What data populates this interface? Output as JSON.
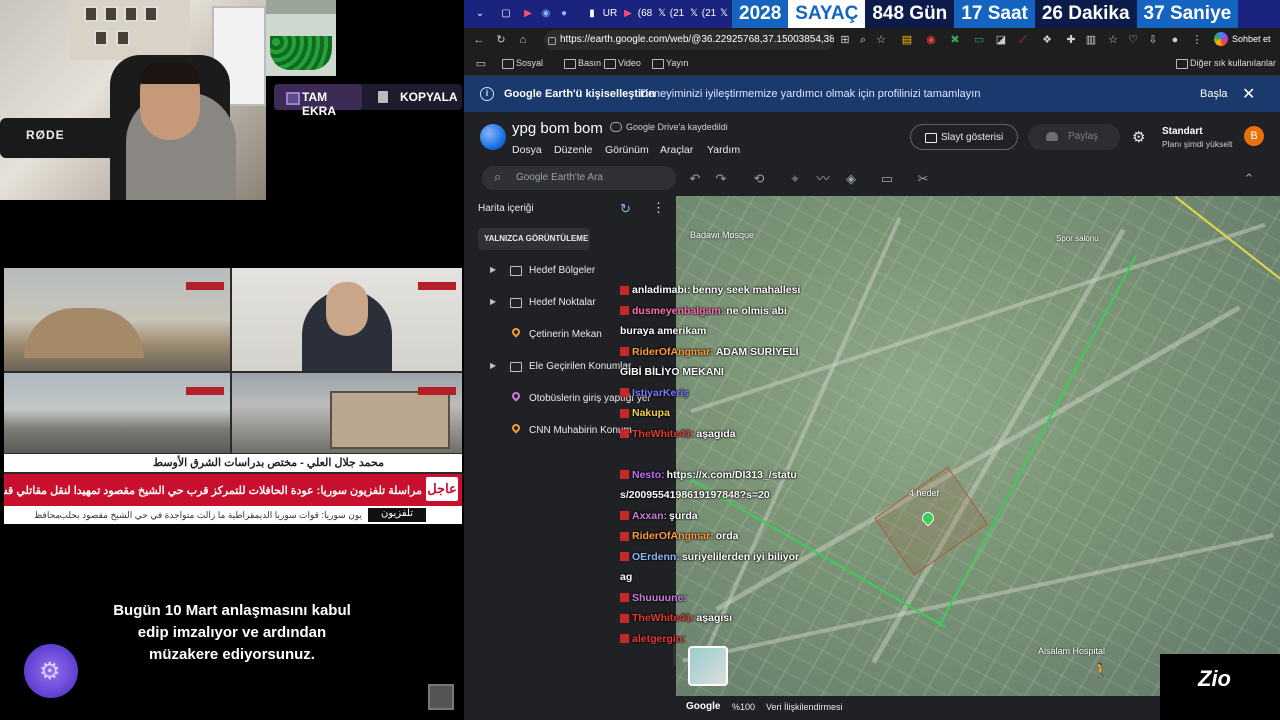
{
  "stream": {
    "overlay_buttons": {
      "fullscreen": "TAM EKRA",
      "copy": "KOPYALA"
    },
    "mic_brand": "RØDE",
    "subtitle": "Bugün 10 Mart anlaşmasını kabul edip imzalıyor ve ardından müzakere ediyorsunuz."
  },
  "news": {
    "ticker_name": "محمد جلال العلي - مختص بدراسات الشرق الأوسط",
    "ticker_headline": "مراسلة تلفزيون سوريا: عودة الحافلات للتمركز قرب حي الشيخ مقصود تمهيدا لنقل مقاتلي قسد",
    "breaking_label": "عاجل",
    "ticker_bottom": "يون سوريا: قوات سوريا الديمقراطية ما زالت متواجدة في حي الشيخ مقصود بحلب",
    "ticker_bottom_left": "محافظ",
    "channel_logo": "تلفزيون"
  },
  "browser": {
    "tabs_short": [
      "UR",
      "(68",
      "(21",
      "(21"
    ],
    "countdown": {
      "year": "2028",
      "label": "SAYAÇ",
      "days": "848 Gün",
      "hours": "17 Saat",
      "minutes": "26 Dakika",
      "seconds": "37 Saniye"
    },
    "url": "https://earth.google.com/web/@36.22925768,37.15003854,38...",
    "chat_button": "Sohbet et",
    "left_bookmarks": "Diğer sık kullanılanlar",
    "bookmarks": [
      "Sosyal",
      "Basın",
      "Video",
      "Yayın"
    ],
    "other_bookmarks": "Diğer sık kullanılanlar"
  },
  "infobar": {
    "title": "Google Earth'ü kişiselleştirin",
    "message": "Deneyiminizi iyileştirmemize yardımcı olmak için profilinizi tamamlayın",
    "start": "Başla"
  },
  "earth": {
    "project_title": "ypg bom bom",
    "saved_status": "Google Drive'a kaydedildi",
    "menu": [
      "Dosya",
      "Düzenle",
      "Görünüm",
      "Araçlar",
      "Yardım"
    ],
    "slideshow": "Slayt gösterisi",
    "share": "Paylaş",
    "plan_name": "Standart",
    "plan_upgrade": "Planı şimdi yükselt",
    "avatar_letter": "B",
    "search_placeholder": "Google Earth'te Ara",
    "panel_title": "Harita içeriği",
    "view_only": "YALNIZCA GÖRÜNTÜLEME",
    "items": [
      {
        "label": "Hedef Bölgeler",
        "kind": "folder"
      },
      {
        "label": "Hedef Noktalar",
        "kind": "folder"
      },
      {
        "label": "Çetinerin Mekan",
        "kind": "pin",
        "color": "#f29b38"
      },
      {
        "label": "Ele Geçirilen Konumlar",
        "kind": "folder"
      },
      {
        "label": "Otobüslerin giriş yaptığı yer",
        "kind": "pin",
        "color": "#c77ddb"
      },
      {
        "label": "CNN Muhabirin Konum",
        "kind": "pin",
        "color": "#f29b38"
      }
    ],
    "map_labels": {
      "badawi": "Badawi Mosque",
      "hedef": "4 hedef",
      "hospital": "Alsalam Hospital",
      "spor": "Spor salonu"
    },
    "footer": {
      "brand": "Google",
      "zoom": "%100",
      "credits": "Veri İlişkilendirmesi"
    }
  },
  "chat": [
    {
      "user": "anladimabi:",
      "text": "benny seek mahallesi",
      "color": "#ffffff"
    },
    {
      "user": "dusmeyenbalgam:",
      "text": "ne olmis abi",
      "color": "#ff6fb5"
    },
    {
      "user": "",
      "text": "buraya amerikam",
      "color": "#ffffff"
    },
    {
      "user": "RiderOfAngmar:",
      "text": "ADAM SURİYELİ",
      "color": "#ff9b3d"
    },
    {
      "user": "",
      "text": "GİBİ BİLİYO MEKANI",
      "color": "#ffffff"
    },
    {
      "user": "IstiyarKeriş",
      "text": "",
      "color": "#7a7aff"
    },
    {
      "user": "Nakupa",
      "text": "",
      "color": "#f2d14a"
    },
    {
      "user": "TheWhite41:",
      "text": "aşagıda",
      "color": "#e53935"
    },
    {
      "user": "",
      "text": "",
      "color": "#ffffff"
    },
    {
      "user": "Nesto:",
      "text": "https://x.com/DI313_/statu",
      "color": "#b96cff"
    },
    {
      "user": "",
      "text": "s/2009554198619197848?s=20",
      "color": "#ffffff"
    },
    {
      "user": "Axxan:",
      "text": "şurda",
      "color": "#c77ddb"
    },
    {
      "user": "RiderOfAngmar:",
      "text": "orda",
      "color": "#ff9b3d"
    },
    {
      "user": "OErdenn:",
      "text": "suriyelilerden iyi biliyor",
      "color": "#8ab4f8"
    },
    {
      "user": "",
      "text": "ag",
      "color": "#ffffff"
    },
    {
      "user": "Shuuuune:",
      "text": "",
      "color": "#c77ddb"
    },
    {
      "user": "TheWhite41:",
      "text": "aşagısı",
      "color": "#e53935"
    },
    {
      "user": "aletgergin:",
      "text": "",
      "color": "#e53935"
    }
  ],
  "watermark": "Zio"
}
